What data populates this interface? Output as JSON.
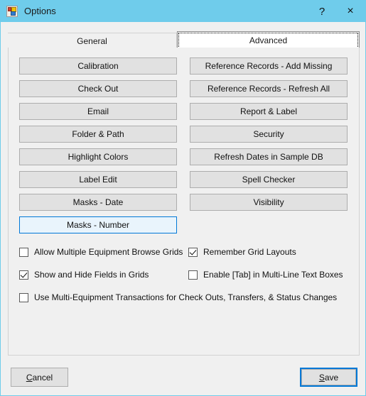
{
  "window": {
    "title": "Options",
    "icon": "app-icon",
    "titlebar_color": "#6FCCEB",
    "help_label": "?",
    "close_label": "×"
  },
  "tabs": [
    {
      "label": "General",
      "selected": false
    },
    {
      "label": "Advanced",
      "selected": true
    }
  ],
  "buttons": {
    "left_column": [
      {
        "label": "Calibration",
        "state": "normal"
      },
      {
        "label": "Check Out",
        "state": "normal"
      },
      {
        "label": "Email",
        "state": "normal"
      },
      {
        "label": "Folder & Path",
        "state": "normal"
      },
      {
        "label": "Highlight Colors",
        "state": "normal"
      },
      {
        "label": "Label Edit",
        "state": "normal"
      },
      {
        "label": "Masks - Date",
        "state": "normal"
      },
      {
        "label": "Masks - Number",
        "state": "highlighted"
      }
    ],
    "right_column": [
      {
        "label": "Reference Records - Add Missing",
        "state": "normal"
      },
      {
        "label": "Reference Records - Refresh All",
        "state": "normal"
      },
      {
        "label": "Report & Label",
        "state": "normal"
      },
      {
        "label": "Security",
        "state": "normal"
      },
      {
        "label": "Refresh Dates in Sample DB",
        "state": "normal"
      },
      {
        "label": "Spell Checker",
        "state": "normal"
      },
      {
        "label": "Visibility",
        "state": "normal"
      }
    ]
  },
  "checkboxes": [
    {
      "label": "Allow Multiple Equipment Browse Grids",
      "checked": false
    },
    {
      "label": "Remember Grid Layouts",
      "checked": true
    },
    {
      "label": "Show and Hide Fields in Grids",
      "checked": true
    },
    {
      "label": "Enable [Tab] in Multi-Line Text Boxes",
      "checked": false
    },
    {
      "label": "Use Multi-Equipment Transactions for Check Outs, Transfers, & Status Changes",
      "checked": false
    }
  ],
  "footer": {
    "cancel": {
      "accel": "C",
      "rest": "ancel"
    },
    "save": {
      "accel": "S",
      "rest": "ave"
    },
    "default_button_color": "#0078D7"
  }
}
